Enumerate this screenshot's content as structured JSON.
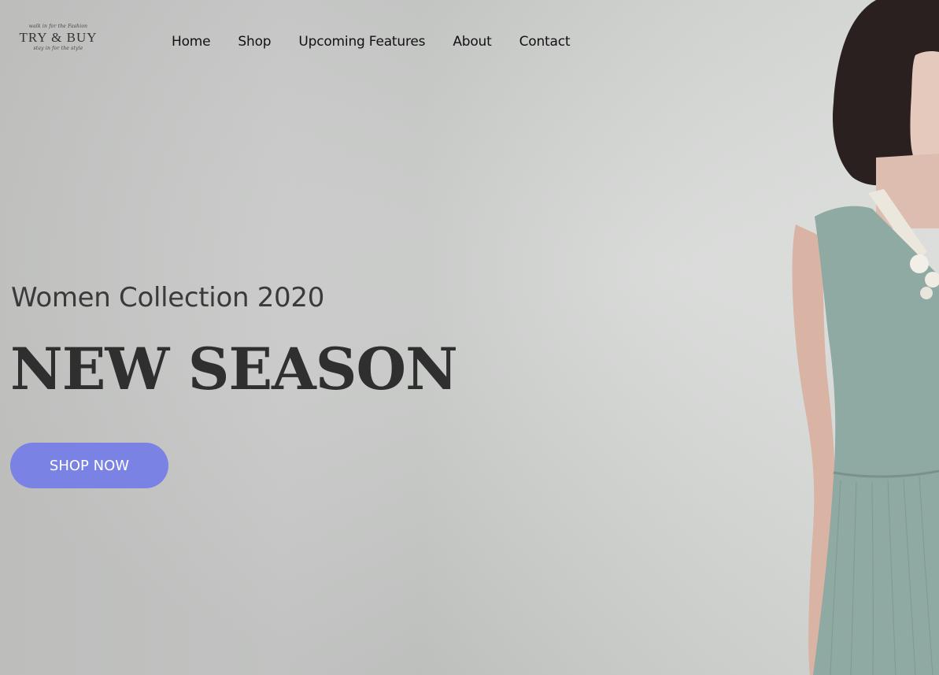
{
  "brand": {
    "tagline_top": "walk in for the Fashion",
    "name": "TRY & BUY",
    "tagline_bottom": "stay in for the style"
  },
  "nav": {
    "items": [
      {
        "label": "Home"
      },
      {
        "label": "Shop"
      },
      {
        "label": "Upcoming Features"
      },
      {
        "label": "About"
      },
      {
        "label": "Contact"
      }
    ]
  },
  "hero": {
    "subtitle": "Women Collection 2020",
    "title": "NEW SEASON",
    "cta_label": "SHOP NOW"
  },
  "colors": {
    "accent": "#7a83e3",
    "dress": "#8fa9a3",
    "background": "#cbcccb"
  }
}
